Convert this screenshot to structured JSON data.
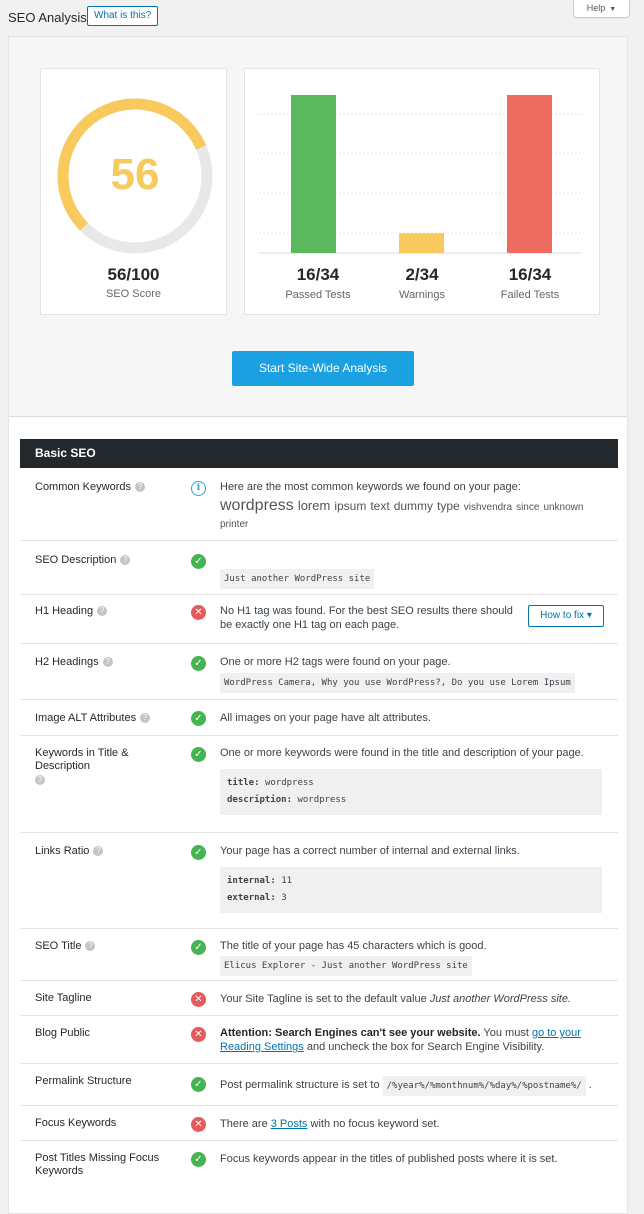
{
  "header": {
    "title": "SEO Analysis",
    "what_is_this": "What is this?",
    "help": "Help"
  },
  "score": {
    "value": "56",
    "text": "56/100",
    "label": "SEO Score",
    "fraction": 0.56,
    "color": "#f8ca5e",
    "track_color": "#e8e8e8"
  },
  "tests": {
    "passed": {
      "value": "16/34",
      "label": "Passed Tests",
      "count": 16,
      "color": "#5cb85c"
    },
    "warnings": {
      "value": "2/34",
      "label": "Warnings",
      "count": 2,
      "color": "#f8ca5e"
    },
    "failed": {
      "value": "16/34",
      "label": "Failed Tests",
      "count": 16,
      "color": "#ee6b5f"
    },
    "total": 34
  },
  "start_button": "Start Site-Wide Analysis",
  "section_title": "Basic SEO",
  "rows": {
    "common_keywords": {
      "name": "Common Keywords",
      "text": "Here are the most common keywords we found on your page:",
      "keywords": [
        "wordpress",
        "lorem",
        "ipsum",
        "text",
        "dummy",
        "type",
        "vishvendra",
        "since",
        "unknown",
        "printer"
      ]
    },
    "seo_description": {
      "name": "SEO Description",
      "code": "Just another WordPress site"
    },
    "h1_heading": {
      "name": "H1 Heading",
      "text": "No H1 tag was found. For the best SEO results there should be exactly one H1 tag on each page.",
      "how_to_fix": "How to fix ▾"
    },
    "h2_headings": {
      "name": "H2 Headings",
      "text": "One or more H2 tags were found on your page.",
      "code": "WordPress Camera, Why you use WordPress?, Do you use Lorem Ipsum"
    },
    "image_alt": {
      "name": "Image ALT Attributes",
      "text": "All images on your page have alt attributes."
    },
    "keywords_title": {
      "name": "Keywords in Title & Description",
      "text": "One or more keywords were found in the title and description of your page.",
      "title_key": "title:",
      "title_val": "wordpress",
      "desc_key": "description:",
      "desc_val": "wordpress"
    },
    "links_ratio": {
      "name": "Links Ratio",
      "text": "Your page has a correct number of internal and external links.",
      "internal_key": "internal:",
      "internal_val": "11",
      "external_key": "external:",
      "external_val": "3"
    },
    "seo_title": {
      "name": "SEO Title",
      "text": "The title of your page has 45 characters which is good.",
      "code": "Elicus Explorer - Just another WordPress site"
    },
    "site_tagline": {
      "name": "Site Tagline",
      "text": "Your Site Tagline is set to the default value ",
      "italic": "Just another WordPress site."
    },
    "blog_public": {
      "name": "Blog Public",
      "bold": "Attention: Search Engines can't see your website.",
      "text1": " You must ",
      "link": "go to your Reading Settings",
      "text2": " and uncheck the box for Search Engine Visibility."
    },
    "permalink": {
      "name": "Permalink Structure",
      "text": "Post permalink structure is set to",
      "code": "/%year%/%monthnum%/%day%/%postname%/",
      "suffix": "."
    },
    "focus_keywords": {
      "name": "Focus Keywords",
      "text1": "There are ",
      "link": "3 Posts",
      "text2": " with no focus keyword set."
    },
    "post_titles": {
      "name": "Post Titles Missing Focus Keywords",
      "text": "Focus keywords appear in the titles of published posts where it is set."
    }
  }
}
